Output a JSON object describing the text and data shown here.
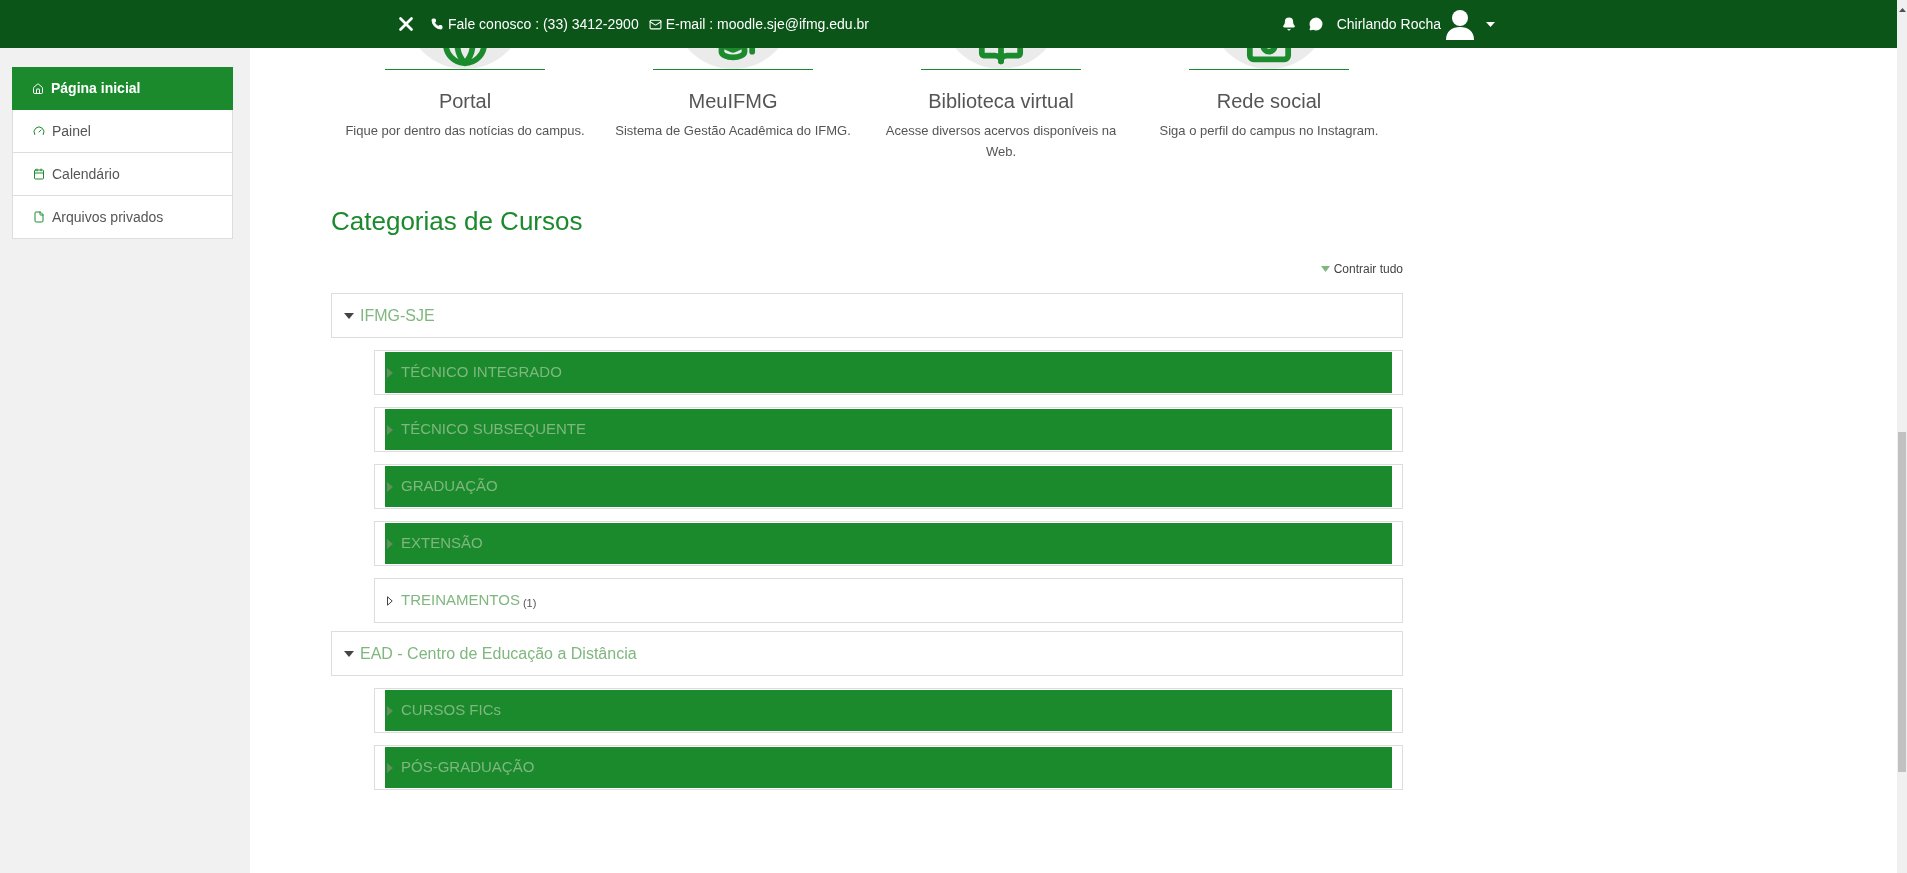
{
  "top_bar": {
    "phone": "Fale conosco : (33) 3412-2900",
    "email": "E-mail : moodle.sje@ifmg.edu.br",
    "user_name": "Chirlando Rocha"
  },
  "sidebar": {
    "items": [
      {
        "label": "Página inicial",
        "selected": true
      },
      {
        "label": "Painel",
        "selected": false
      },
      {
        "label": "Calendário",
        "selected": false
      },
      {
        "label": "Arquivos privados",
        "selected": false
      }
    ]
  },
  "links": [
    {
      "title": "Portal",
      "description": "Fique por dentro das notícias do campus."
    },
    {
      "title": "MeuIFMG",
      "description": "Sistema de Gestão Acadêmica do IFMG."
    },
    {
      "title": "Biblioteca virtual",
      "description": "Acesse diversos acervos disponíveis na Web."
    },
    {
      "title": "Rede social",
      "description": "Siga o perfil do campus no Instagram."
    }
  ],
  "categories": {
    "title": "Categorias de Cursos",
    "collapse_all": "Contrair tudo",
    "items": [
      {
        "name": "IFMG-SJE",
        "expanded": true,
        "children": [
          {
            "name": "TÉCNICO INTEGRADO",
            "selected": true
          },
          {
            "name": "TÉCNICO SUBSEQUENTE",
            "selected": true
          },
          {
            "name": "GRADUAÇÃO",
            "selected": true
          },
          {
            "name": "EXTENSÃO",
            "selected": true
          },
          {
            "name": "TREINAMENTOS",
            "selected": false,
            "count": "(1)"
          }
        ]
      },
      {
        "name": "EAD - Centro de Educação a Distância",
        "expanded": true,
        "children": [
          {
            "name": "CURSOS FICs",
            "selected": true
          },
          {
            "name": "PÓS-GRADUAÇÃO",
            "selected": true
          }
        ]
      }
    ]
  }
}
